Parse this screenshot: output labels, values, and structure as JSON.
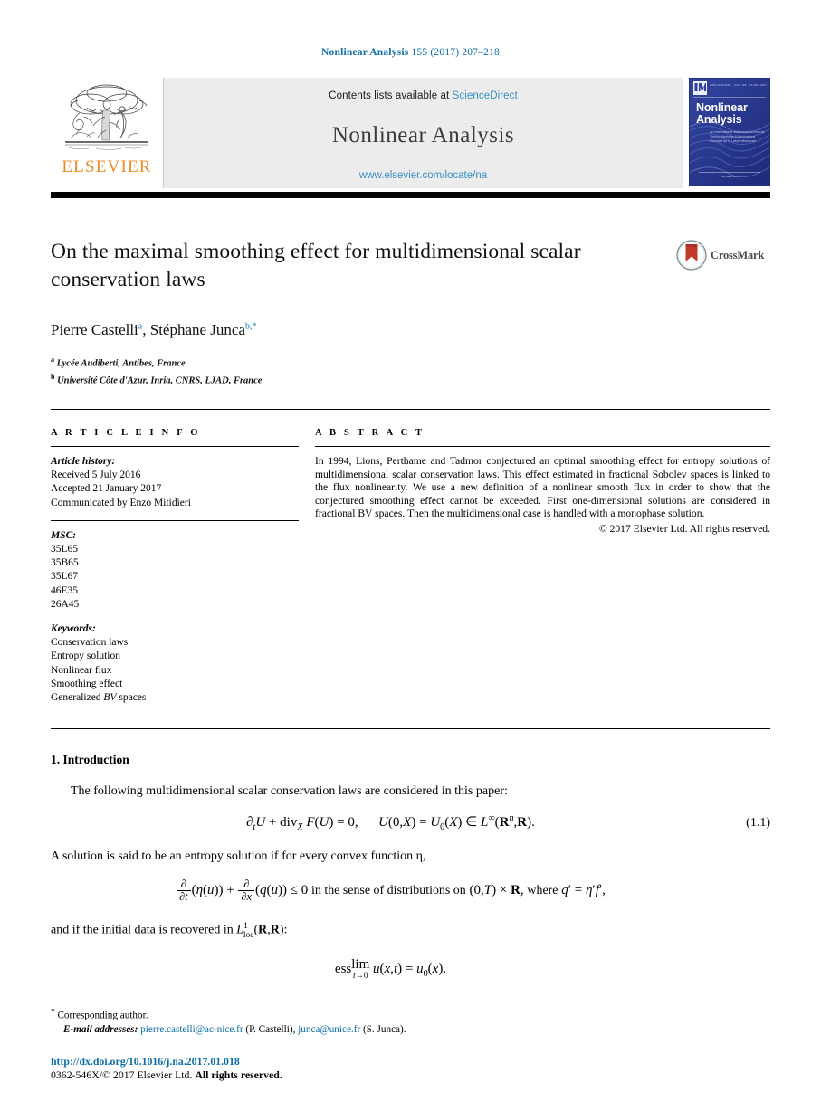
{
  "running_head": {
    "journal": "Nonlinear Analysis",
    "volume_info": "155 (2017) 207–218"
  },
  "masthead": {
    "publisher_wordmark": "ELSEVIER",
    "contents_prefix": "Contents lists available at",
    "sciencedirect": "ScienceDirect",
    "journal_title": "Nonlinear Analysis",
    "journal_url": "www.elsevier.com/locate/na",
    "cover": {
      "title_line1": "Nonlinear",
      "title_line2": "Analysis",
      "subtitle": "An International Mathematical Journal\nTheory, Methods & Applications\nFounded by V. Lakshmikantham",
      "issn_left": "ISSN 0362-546X",
      "issn_mid": "VOL. 155",
      "issn_right": "15 MAY 2017",
      "footer": "AVAILABLE ONLINE\nELSEVIER"
    }
  },
  "article": {
    "title": "On the maximal smoothing effect for multidimensional scalar conservation laws",
    "authors": [
      {
        "name": "Pierre Castelli",
        "marks": "a"
      },
      {
        "name": "Stéphane Junca",
        "marks": "b,*"
      }
    ],
    "authors_line_separator": ", ",
    "affiliations": [
      {
        "mark": "a",
        "text": "Lycée Audiberti, Antibes, France"
      },
      {
        "mark": "b",
        "text": "Université Côte d'Azur, Inria, CNRS, LJAD, France"
      }
    ],
    "crossmark_label": "CrossMark"
  },
  "article_info": {
    "heading": "A R T I C L E   I N F O",
    "history_label": "Article history:",
    "history": [
      "Received 5 July 2016",
      "Accepted 21 January 2017",
      "Communicated by Enzo Mitidieri"
    ],
    "msc_label": "MSC:",
    "msc": [
      "35L65",
      "35B65",
      "35L67",
      "46E35",
      "26A45"
    ],
    "keywords_label": "Keywords:",
    "keywords": [
      "Conservation laws",
      "Entropy solution",
      "Nonlinear flux",
      "Smoothing effect",
      "Generalized BV spaces"
    ]
  },
  "abstract": {
    "heading": "A B S T R A C T",
    "text": "In 1994, Lions, Perthame and Tadmor conjectured an optimal smoothing effect for entropy solutions of multidimensional scalar conservation laws. This effect estimated in fractional Sobolev spaces is linked to the flux nonlinearity. We use a new definition of a nonlinear smooth flux in order to show that the conjectured smoothing effect cannot be exceeded. First one-dimensional solutions are considered in fractional BV spaces. Then the multidimensional case is handled with a monophase solution.",
    "copyright": "© 2017 Elsevier Ltd. All rights reserved."
  },
  "body": {
    "section_number_title": "1. Introduction",
    "paragraph_1": "The following multidimensional scalar conservation laws are considered in this paper:",
    "equation_1_1_number": "(1.1)",
    "paragraph_2": "A solution is said to be an entropy solution if for every convex function η,",
    "paragraph_3": "and if the initial data is recovered in",
    "paragraph_3_tail": ":"
  },
  "footnotes": {
    "corresponding_marker": "*",
    "corresponding_text": "Corresponding author.",
    "emails_label": "E-mail addresses:",
    "email_1": "pierre.castelli@ac-nice.fr",
    "email_1_owner": "(P. Castelli),",
    "email_2": "junca@unice.fr",
    "email_2_owner": "(S. Junca)."
  },
  "footer": {
    "doi": "http://dx.doi.org/10.1016/j.na.2017.01.018",
    "issn_line": "0362-546X/",
    "copyright_line": "© 2017 Elsevier Ltd.",
    "rights": "All rights reserved."
  },
  "colors": {
    "link_blue": "#0b6ea8",
    "sciencedirect_blue": "#3a8fc4",
    "elsevier_orange": "#ec8b22",
    "cover_blue": "#2b3f9e",
    "masthead_gray": "#ececec"
  }
}
